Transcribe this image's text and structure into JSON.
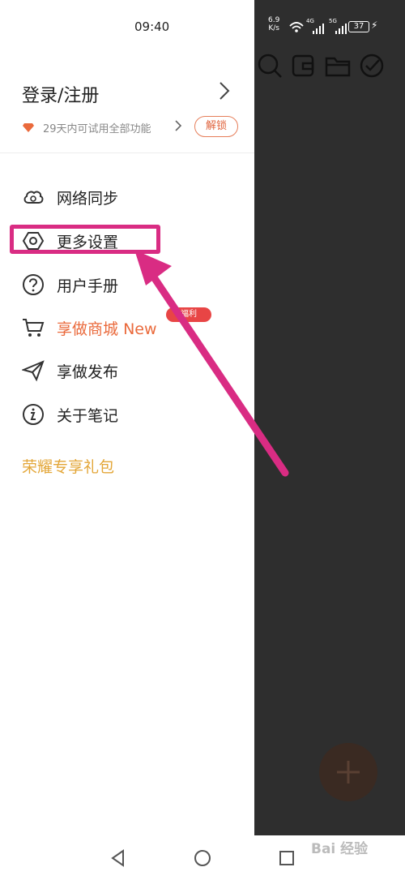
{
  "status_bar": {
    "time": "09:40",
    "net_speed_value": "6.9",
    "net_speed_unit": "K/s",
    "signal_1_label": "4G",
    "signal_2_label": "5G",
    "battery": "37"
  },
  "header": {
    "login_label": "登录/注册",
    "trial_text": "29天内可试用全部功能",
    "unlock_label": "解锁"
  },
  "menu": {
    "items": [
      {
        "label": "网络同步",
        "icon": "cloud-sync-icon"
      },
      {
        "label": "更多设置",
        "icon": "hexagon-settings-icon"
      },
      {
        "label": "用户手册",
        "icon": "help-circle-icon"
      },
      {
        "label": "享做商城",
        "new_tag": "New",
        "badge": "福利",
        "icon": "cart-icon"
      },
      {
        "label": "享做发布",
        "icon": "send-icon"
      },
      {
        "label": "关于笔记",
        "icon": "info-circle-icon"
      }
    ],
    "gift_label": "荣耀专享礼包"
  },
  "background_app": {
    "toolbar_icons": [
      "search-icon",
      "wallet-icon",
      "folder-icon",
      "check-circle-icon"
    ],
    "fab_icon": "plus-icon"
  },
  "nav_bar": {
    "buttons": [
      "back-icon",
      "home-icon",
      "recents-icon"
    ]
  },
  "watermark": "Bai 经验",
  "colors": {
    "accent": "#ea6a3c",
    "gift": "#e3a637",
    "annotation": "#d92c83",
    "badge": "#e84545",
    "overlay": "#2e2e2e"
  }
}
